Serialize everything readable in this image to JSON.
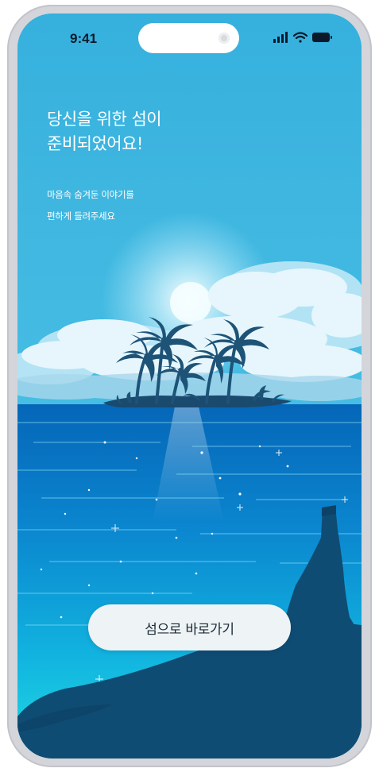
{
  "status_bar": {
    "time": "9:41",
    "icons": [
      "signal-icon",
      "wifi-icon",
      "battery-icon"
    ]
  },
  "intro": {
    "headline_line1": "당신을 위한 섬이",
    "headline_line2": "준비되었어요!",
    "subtext_line1": "마음속 숨겨둔 이야기를",
    "subtext_line2": "편하게 들려주세요"
  },
  "cta": {
    "label": "섬으로 바로가기"
  },
  "colors": {
    "sky": "#35b2db",
    "sea": "#0a74c2",
    "silhouette": "#0f4c73",
    "button_bg": "#eef3f5"
  }
}
